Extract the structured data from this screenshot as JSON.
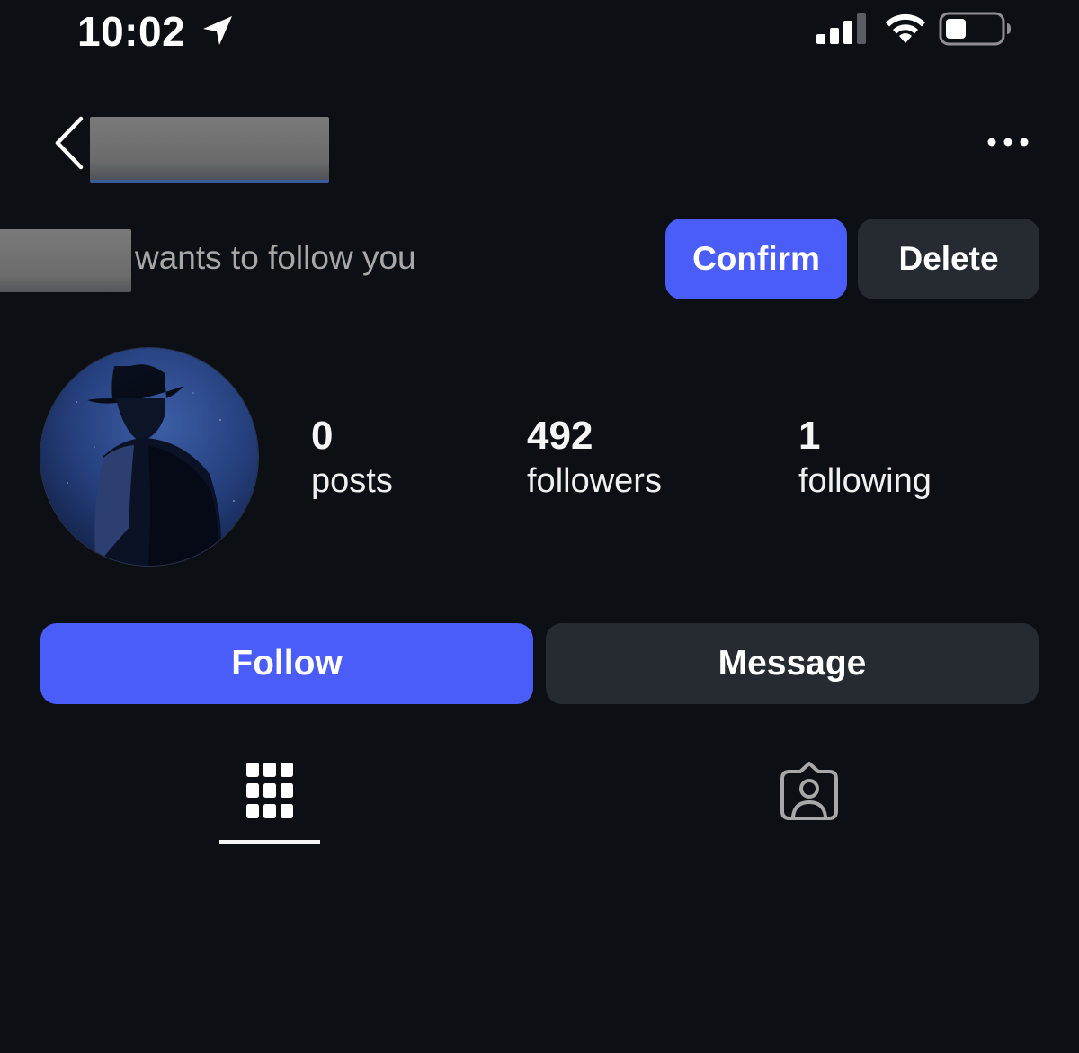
{
  "status_bar": {
    "time": "10:02",
    "icons": [
      "location-arrow-icon",
      "cellular-signal-icon",
      "wifi-icon",
      "battery-icon"
    ]
  },
  "header": {
    "back_icon": "chevron-left-icon",
    "username": "[redacted]",
    "more_icon": "more-horizontal-icon"
  },
  "follow_request": {
    "requester": "[redacted]",
    "text": "wants to follow you",
    "confirm_label": "Confirm",
    "delete_label": "Delete"
  },
  "profile": {
    "avatar": "profile-photo",
    "stats": {
      "posts": {
        "value": "0",
        "label": "posts"
      },
      "followers": {
        "value": "492",
        "label": "followers"
      },
      "following": {
        "value": "1",
        "label": "following"
      }
    }
  },
  "actions": {
    "follow_label": "Follow",
    "message_label": "Message"
  },
  "tabs": [
    {
      "icon": "grid-icon",
      "active": true
    },
    {
      "icon": "tagged-person-icon",
      "active": false
    }
  ],
  "colors": {
    "background": "#0c1014",
    "primary_button": "#4a5df9",
    "secondary_button": "#262a31",
    "muted_text": "#a8a8a8"
  }
}
